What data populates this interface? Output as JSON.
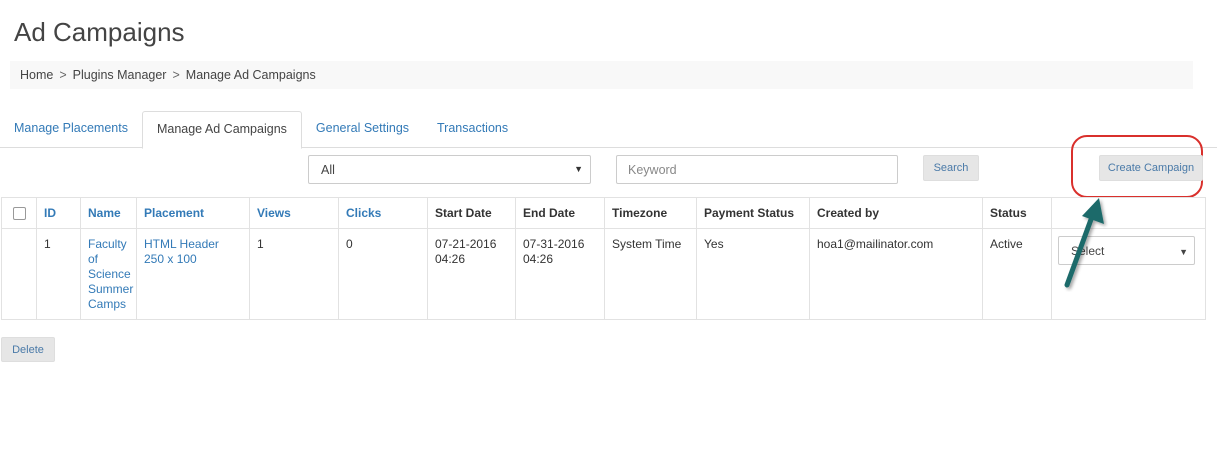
{
  "page": {
    "title": "Ad Campaigns"
  },
  "breadcrumb": [
    "Home",
    "Plugins Manager",
    "Manage Ad Campaigns"
  ],
  "breadcrumb_separator": ">",
  "tabs": [
    {
      "label": "Manage Placements",
      "active": false
    },
    {
      "label": "Manage Ad Campaigns",
      "active": true
    },
    {
      "label": "General Settings",
      "active": false
    },
    {
      "label": "Transactions",
      "active": false
    }
  ],
  "filters": {
    "select_value": "All",
    "keyword_placeholder": "Keyword",
    "search_label": "Search",
    "create_label": "Create Campaign"
  },
  "table": {
    "headers": [
      "ID",
      "Name",
      "Placement",
      "Views",
      "Clicks",
      "Start Date",
      "End Date",
      "Timezone",
      "Payment Status",
      "Created by",
      "Status"
    ],
    "rows": [
      {
        "id": "1",
        "name": "Faculty of Science Summer Camps",
        "placement": "HTML Header 250 x 100",
        "views": "1",
        "clicks": "0",
        "start_date": "07-21-2016 04:26",
        "end_date": "07-31-2016 04:26",
        "timezone": "System Time",
        "payment_status": "Yes",
        "created_by": "hoa1@mailinator.com",
        "status": "Active",
        "action_select": "Select"
      }
    ]
  },
  "actions": {
    "delete_label": "Delete"
  },
  "icons": {
    "select_caret": "caret-down-icon",
    "annotation": "arrow-icon"
  },
  "colors": {
    "link": "#337ab7",
    "highlight": "#d9302c",
    "arrow": "#1f6b6b"
  }
}
